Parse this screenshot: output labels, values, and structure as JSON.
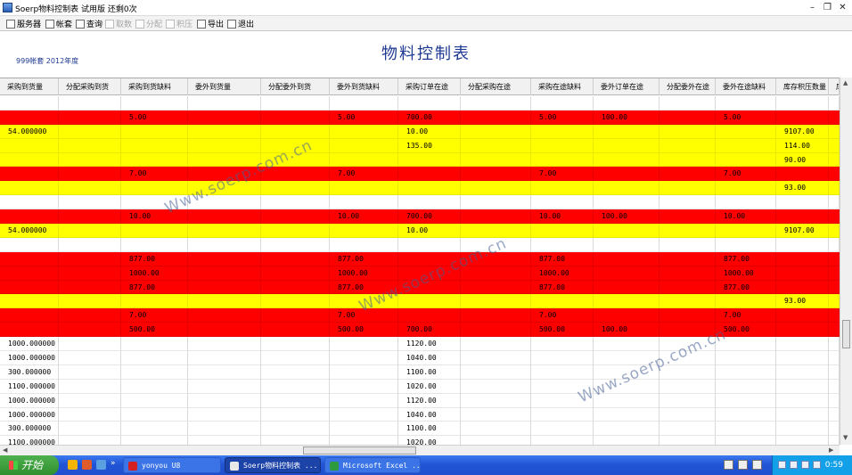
{
  "window": {
    "title": "Soerp物料控制表 试用版  还剩0次",
    "minimize_glyph": "–",
    "restore_glyph": "❐",
    "close_glyph": "✕"
  },
  "toolbar": {
    "items": [
      {
        "label": "服务器",
        "enabled": true,
        "icon": "server-icon"
      },
      {
        "label": "帐套",
        "enabled": true,
        "icon": "account-book-icon"
      },
      {
        "label": "查询",
        "enabled": true,
        "icon": "filter-icon"
      },
      {
        "label": "取数",
        "enabled": false,
        "icon": "fetch-data-icon"
      },
      {
        "label": "分配",
        "enabled": false,
        "icon": "allocate-icon"
      },
      {
        "label": "积压",
        "enabled": false,
        "icon": "backlog-icon"
      },
      {
        "label": "导出",
        "enabled": true,
        "icon": "export-icon"
      },
      {
        "label": "退出",
        "enabled": true,
        "icon": "exit-icon"
      }
    ]
  },
  "header": {
    "title": "物料控制表",
    "subtitle": "999帐套 2012年度"
  },
  "grid": {
    "columns": [
      "采购到货量",
      "分配采购到货",
      "采购到货缺料",
      "委外到货量",
      "分配委外到货",
      "委外到货缺料",
      "采购订单在途",
      "分配采购在途",
      "采购在途缺料",
      "委外订单在途",
      "分配委外在途",
      "委外在途缺料",
      "库存积压数量",
      "库"
    ],
    "rows": [
      {
        "color": "white",
        "cells": [
          "",
          "",
          "",
          "",
          "",
          "",
          "",
          "",
          "",
          "",
          "",
          "",
          "",
          ""
        ]
      },
      {
        "color": "red",
        "cells": [
          "",
          "",
          "5.00",
          "",
          "",
          "5.00",
          "700.00",
          "",
          "5.00",
          "100.00",
          "",
          "5.00",
          "",
          ""
        ]
      },
      {
        "color": "yellow",
        "cells": [
          "54.000000",
          "",
          "",
          "",
          "",
          "",
          "10.00",
          "",
          "",
          "",
          "",
          "",
          "9107.00",
          ""
        ]
      },
      {
        "color": "yellow",
        "cells": [
          "",
          "",
          "",
          "",
          "",
          "",
          "135.00",
          "",
          "",
          "",
          "",
          "",
          "114.00",
          ""
        ]
      },
      {
        "color": "yellow",
        "cells": [
          "",
          "",
          "",
          "",
          "",
          "",
          "",
          "",
          "",
          "",
          "",
          "",
          "90.00",
          ""
        ]
      },
      {
        "color": "red",
        "cells": [
          "",
          "",
          "7.00",
          "",
          "",
          "7.00",
          "",
          "",
          "7.00",
          "",
          "",
          "7.00",
          "",
          ""
        ]
      },
      {
        "color": "yellow",
        "cells": [
          "",
          "",
          "",
          "",
          "",
          "",
          "",
          "",
          "",
          "",
          "",
          "",
          "93.00",
          ""
        ]
      },
      {
        "color": "white",
        "cells": [
          "",
          "",
          "",
          "",
          "",
          "",
          "",
          "",
          "",
          "",
          "",
          "",
          "",
          ""
        ]
      },
      {
        "color": "red",
        "cells": [
          "",
          "",
          "10.00",
          "",
          "",
          "10.00",
          "700.00",
          "",
          "10.00",
          "100.00",
          "",
          "10.00",
          "",
          ""
        ]
      },
      {
        "color": "yellow",
        "cells": [
          "54.000000",
          "",
          "",
          "",
          "",
          "",
          "10.00",
          "",
          "",
          "",
          "",
          "",
          "9107.00",
          ""
        ]
      },
      {
        "color": "white",
        "cells": [
          "",
          "",
          "",
          "",
          "",
          "",
          "",
          "",
          "",
          "",
          "",
          "",
          "",
          ""
        ]
      },
      {
        "color": "red",
        "cells": [
          "",
          "",
          "877.00",
          "",
          "",
          "877.00",
          "",
          "",
          "877.00",
          "",
          "",
          "877.00",
          "",
          ""
        ]
      },
      {
        "color": "red",
        "cells": [
          "",
          "",
          "1000.00",
          "",
          "",
          "1000.00",
          "",
          "",
          "1000.00",
          "",
          "",
          "1000.00",
          "",
          ""
        ]
      },
      {
        "color": "red",
        "cells": [
          "",
          "",
          "877.00",
          "",
          "",
          "877.00",
          "",
          "",
          "877.00",
          "",
          "",
          "877.00",
          "",
          ""
        ]
      },
      {
        "color": "yellow",
        "cells": [
          "",
          "",
          "",
          "",
          "",
          "",
          "",
          "",
          "",
          "",
          "",
          "",
          "93.00",
          ""
        ]
      },
      {
        "color": "red",
        "cells": [
          "",
          "",
          "7.00",
          "",
          "",
          "7.00",
          "",
          "",
          "7.00",
          "",
          "",
          "7.00",
          "",
          ""
        ]
      },
      {
        "color": "red",
        "cells": [
          "",
          "",
          "500.00",
          "",
          "",
          "500.00",
          "700.00",
          "",
          "500.00",
          "100.00",
          "",
          "500.00",
          "",
          ""
        ]
      },
      {
        "color": "white",
        "cells": [
          "1000.000000",
          "",
          "",
          "",
          "",
          "",
          "1120.00",
          "",
          "",
          "",
          "",
          "",
          "",
          ""
        ]
      },
      {
        "color": "white",
        "cells": [
          "1000.000000",
          "",
          "",
          "",
          "",
          "",
          "1040.00",
          "",
          "",
          "",
          "",
          "",
          "",
          ""
        ]
      },
      {
        "color": "white",
        "cells": [
          "300.000000",
          "",
          "",
          "",
          "",
          "",
          "1100.00",
          "",
          "",
          "",
          "",
          "",
          "",
          ""
        ]
      },
      {
        "color": "white",
        "cells": [
          "1100.000000",
          "",
          "",
          "",
          "",
          "",
          "1020.00",
          "",
          "",
          "",
          "",
          "",
          "",
          ""
        ]
      },
      {
        "color": "white",
        "cells": [
          "1000.000000",
          "",
          "",
          "",
          "",
          "",
          "1120.00",
          "",
          "",
          "",
          "",
          "",
          "",
          ""
        ]
      },
      {
        "color": "white",
        "cells": [
          "1000.000000",
          "",
          "",
          "",
          "",
          "",
          "1040.00",
          "",
          "",
          "",
          "",
          "",
          "",
          ""
        ]
      },
      {
        "color": "white",
        "cells": [
          "300.000000",
          "",
          "",
          "",
          "",
          "",
          "1100.00",
          "",
          "",
          "",
          "",
          "",
          "",
          ""
        ]
      },
      {
        "color": "white",
        "cells": [
          "1100.000000",
          "",
          "",
          "",
          "",
          "",
          "1020.00",
          "",
          "",
          "",
          "",
          "",
          "",
          ""
        ]
      }
    ]
  },
  "watermark": "Www.soerp.com.cn",
  "colors": {
    "row_red": "#ff0000",
    "row_yellow": "#ffff00",
    "title_blue": "#1f3a93",
    "taskbar_blue": "#2154d6",
    "start_green": "#3a9a3a"
  },
  "taskbar": {
    "start_label": "开始",
    "overflow_glyph": "»",
    "tasks": [
      {
        "label": "yonyou U8",
        "active": false,
        "icon": "u8-app-icon"
      },
      {
        "label": "Soerp物料控制表 ...",
        "active": true,
        "icon": "soerp-app-icon"
      },
      {
        "label": "Microsoft Excel ...",
        "active": false,
        "icon": "excel-app-icon"
      }
    ],
    "clock": "0:59"
  }
}
